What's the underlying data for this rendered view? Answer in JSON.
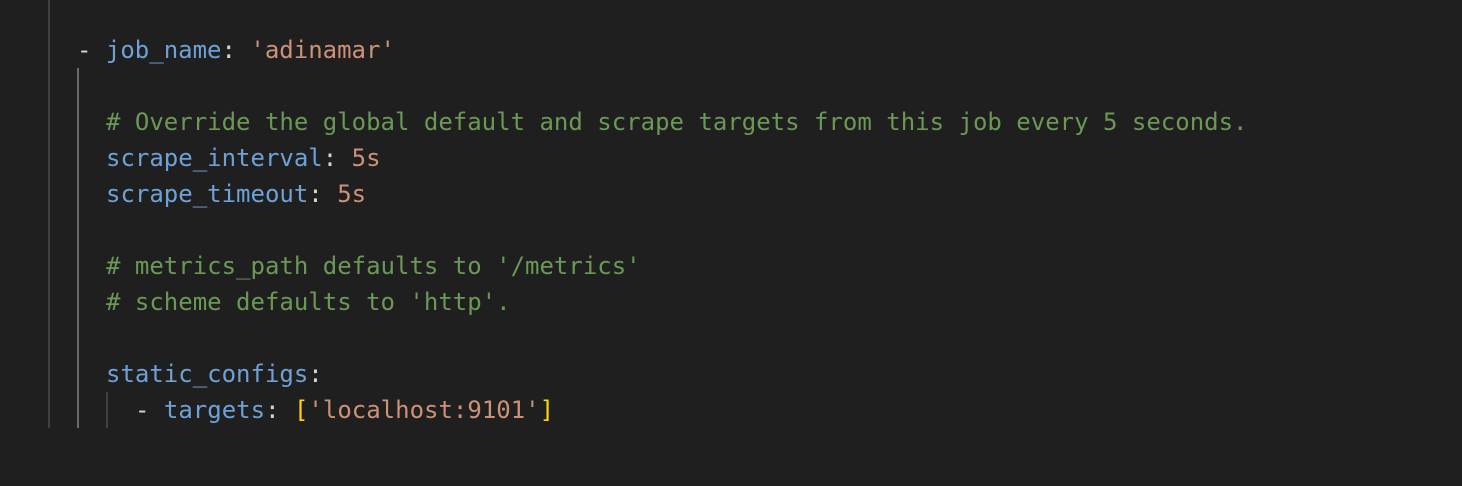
{
  "code": {
    "line1": {
      "dash": "-",
      "key": "job_name",
      "colon": ": ",
      "value": "'adinamar'"
    },
    "line3": {
      "comment": "# Override the global default and scrape targets from this job every 5 seconds."
    },
    "line4": {
      "key": "scrape_interval",
      "colon": ": ",
      "value": "5s"
    },
    "line5": {
      "key": "scrape_timeout",
      "colon": ": ",
      "value": "5s"
    },
    "line7": {
      "comment": "# metrics_path defaults to '/metrics'"
    },
    "line8": {
      "comment": "# scheme defaults to 'http'."
    },
    "line10": {
      "key": "static_configs",
      "colon": ":"
    },
    "line11": {
      "dash": "-",
      "key": "targets",
      "colon": ": ",
      "open": "[",
      "value": "'localhost:9101'",
      "close": "]"
    }
  },
  "colors": {
    "background": "#1f1f1f",
    "key": "#6ea1d6",
    "string": "#ce9178",
    "comment": "#6a9955",
    "bracket": "#ffd700"
  }
}
